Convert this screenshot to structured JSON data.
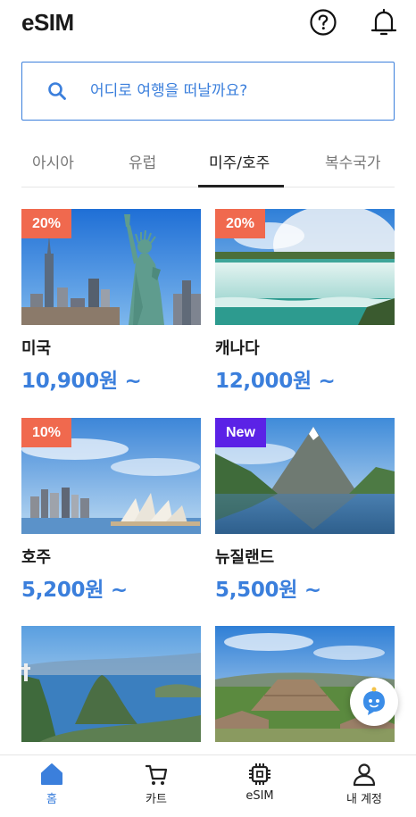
{
  "header": {
    "title": "eSIM",
    "help_icon": "question-circle-icon",
    "bell_icon": "bell-icon"
  },
  "search": {
    "placeholder": "어디로 여행을 떠날까요?",
    "icon": "search-icon"
  },
  "tabs": [
    {
      "label": "아시아",
      "active": false
    },
    {
      "label": "유럽",
      "active": false
    },
    {
      "label": "미주/호주",
      "active": true
    },
    {
      "label": "복수국가",
      "active": false
    }
  ],
  "products": [
    {
      "name": "미국",
      "price": "10,900원 ~",
      "badge": "20%",
      "badge_type": "discount"
    },
    {
      "name": "캐나다",
      "price": "12,000원 ~",
      "badge": "20%",
      "badge_type": "discount"
    },
    {
      "name": "호주",
      "price": "5,200원 ~",
      "badge": "10%",
      "badge_type": "discount"
    },
    {
      "name": "뉴질랜드",
      "price": "5,500원 ~",
      "badge": "New",
      "badge_type": "new"
    },
    {
      "name": "",
      "price": "",
      "badge": "",
      "badge_type": ""
    },
    {
      "name": "",
      "price": "",
      "badge": "",
      "badge_type": ""
    }
  ],
  "bottom_nav": [
    {
      "label": "홈",
      "icon": "home-icon",
      "active": true
    },
    {
      "label": "카트",
      "icon": "cart-icon",
      "active": false
    },
    {
      "label": "eSIM",
      "icon": "chip-icon",
      "active": false
    },
    {
      "label": "내 계정",
      "icon": "user-icon",
      "active": false
    }
  ],
  "colors": {
    "accent": "#3b7fdc",
    "discount_badge": "#f0694e",
    "new_badge": "#5b22e6"
  }
}
